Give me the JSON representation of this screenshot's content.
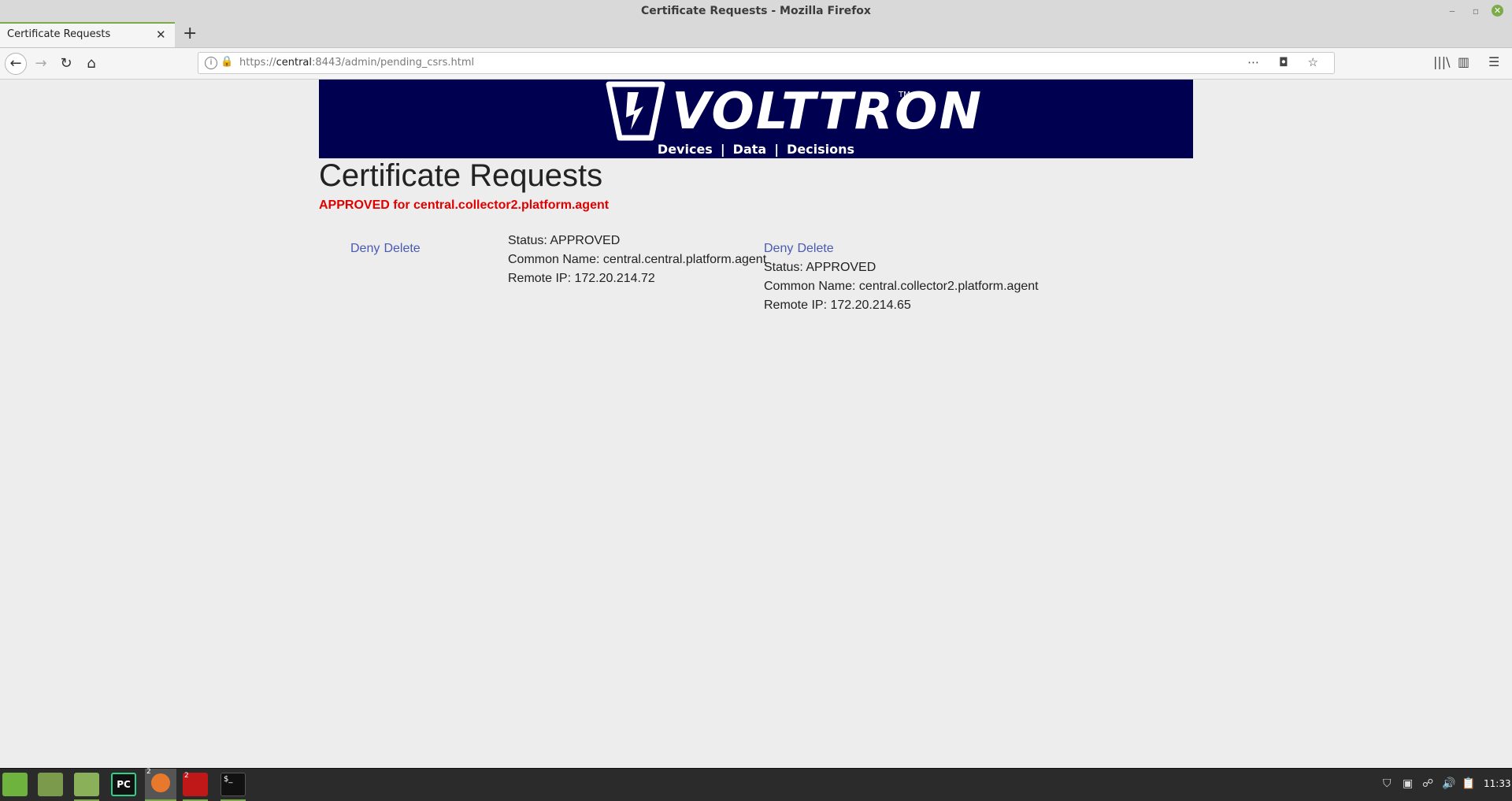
{
  "window": {
    "title": "Certificate Requests - Mozilla Firefox",
    "minimize": "‒",
    "maximize": "▫",
    "close": "✕"
  },
  "tab": {
    "label": "Certificate Requests",
    "close": "✕",
    "new_tab": "+"
  },
  "nav": {
    "back": "←",
    "forward": "→",
    "reload": "↻",
    "home": "⌂",
    "url_scheme": "https://",
    "url_host": "central",
    "url_rest": ":8443/admin/pending_csrs.html",
    "url_actions": "⋯ ◘ ☆",
    "library": "|||\\",
    "sidebar": "▥",
    "menu": "☰",
    "info": "i",
    "lock": "🔒"
  },
  "banner": {
    "logo_text": "VOLTTRON",
    "trademark": "TM",
    "links": [
      {
        "label": "Devices"
      },
      {
        "label": "Data"
      },
      {
        "label": "Decisions"
      }
    ],
    "separator": "|",
    "colors": {
      "background": "#000050",
      "text": "#ffffff"
    }
  },
  "page": {
    "title": "Certificate Requests",
    "flash": "APPROVED for central.collector2.platform.agent"
  },
  "requests": [
    {
      "deny_label": "Deny",
      "delete_label": "Delete",
      "status": "Status: APPROVED",
      "common_name": "Common Name: central.central.platform.agent",
      "remote_ip": "Remote IP: 172.20.214.72"
    },
    {
      "deny_label": "Deny",
      "delete_label": "Delete",
      "status": "Status: APPROVED",
      "common_name": "Common Name: central.collector2.platform.agent",
      "remote_ip": "Remote IP: 172.20.214.65"
    }
  ],
  "taskbar": {
    "pycharm_label": "PC",
    "firefox_badge": "2",
    "redterm_badge": "2",
    "term_label": "$_",
    "tray_icons": [
      "shield-icon",
      "app-icon",
      "network-icon",
      "volume-icon",
      "clipboard-icon"
    ],
    "tray_glyphs": [
      "⛉",
      "▣",
      "☍",
      "🔊",
      "📋"
    ],
    "clock": "11:33"
  },
  "colors": {
    "link": "#4a5ab0",
    "flash": "#e00000",
    "accent": "#7eab4a"
  }
}
